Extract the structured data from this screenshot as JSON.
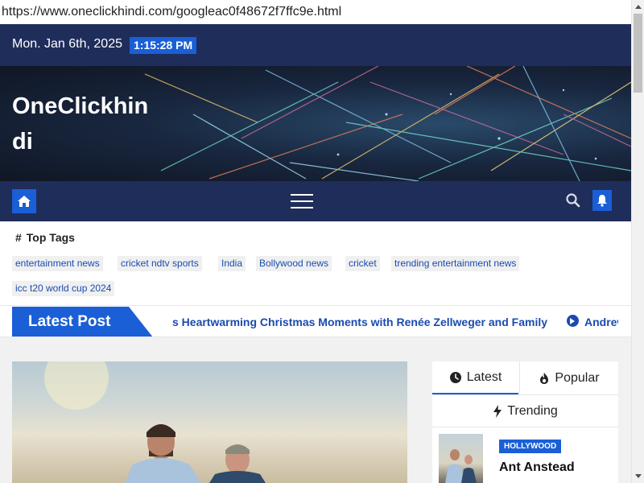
{
  "browser": {
    "url": "https://www.oneclickhindi.com/googleac0f48672f7ffc9e.html"
  },
  "topbar": {
    "date": "Mon. Jan 6th, 2025",
    "time": "1:15:28 PM"
  },
  "header": {
    "site_title": "OneClickhindi"
  },
  "nav": {
    "home_icon": "home-icon",
    "menu_icon": "hamburger-icon",
    "search_icon": "search-icon",
    "bell_icon": "bell-icon"
  },
  "tags": {
    "heading_symbol": "#",
    "heading": "Top Tags",
    "items": [
      "entertainment news",
      "cricket ndtv sports",
      "India",
      "Bollywood news",
      "cricket",
      "trending entertainment news",
      "icc t20 world cup 2024"
    ]
  },
  "ticker": {
    "label": "Latest Post",
    "text": "s Heartwarming Christmas Moments with Renée Zellweger and Family",
    "next_text": "Andrew"
  },
  "sidebar": {
    "tabs": [
      {
        "label": "Latest",
        "icon": "clock-icon"
      },
      {
        "label": "Popular",
        "icon": "fire-icon"
      },
      {
        "label": "Trending",
        "icon": "bolt-icon"
      }
    ],
    "post": {
      "category": "HOLLYWOOD",
      "title": "Ant Anstead"
    }
  },
  "colors": {
    "navy": "#1f2d5a",
    "accent_blue": "#1a5fd6",
    "link_blue": "#1a4bb0"
  }
}
